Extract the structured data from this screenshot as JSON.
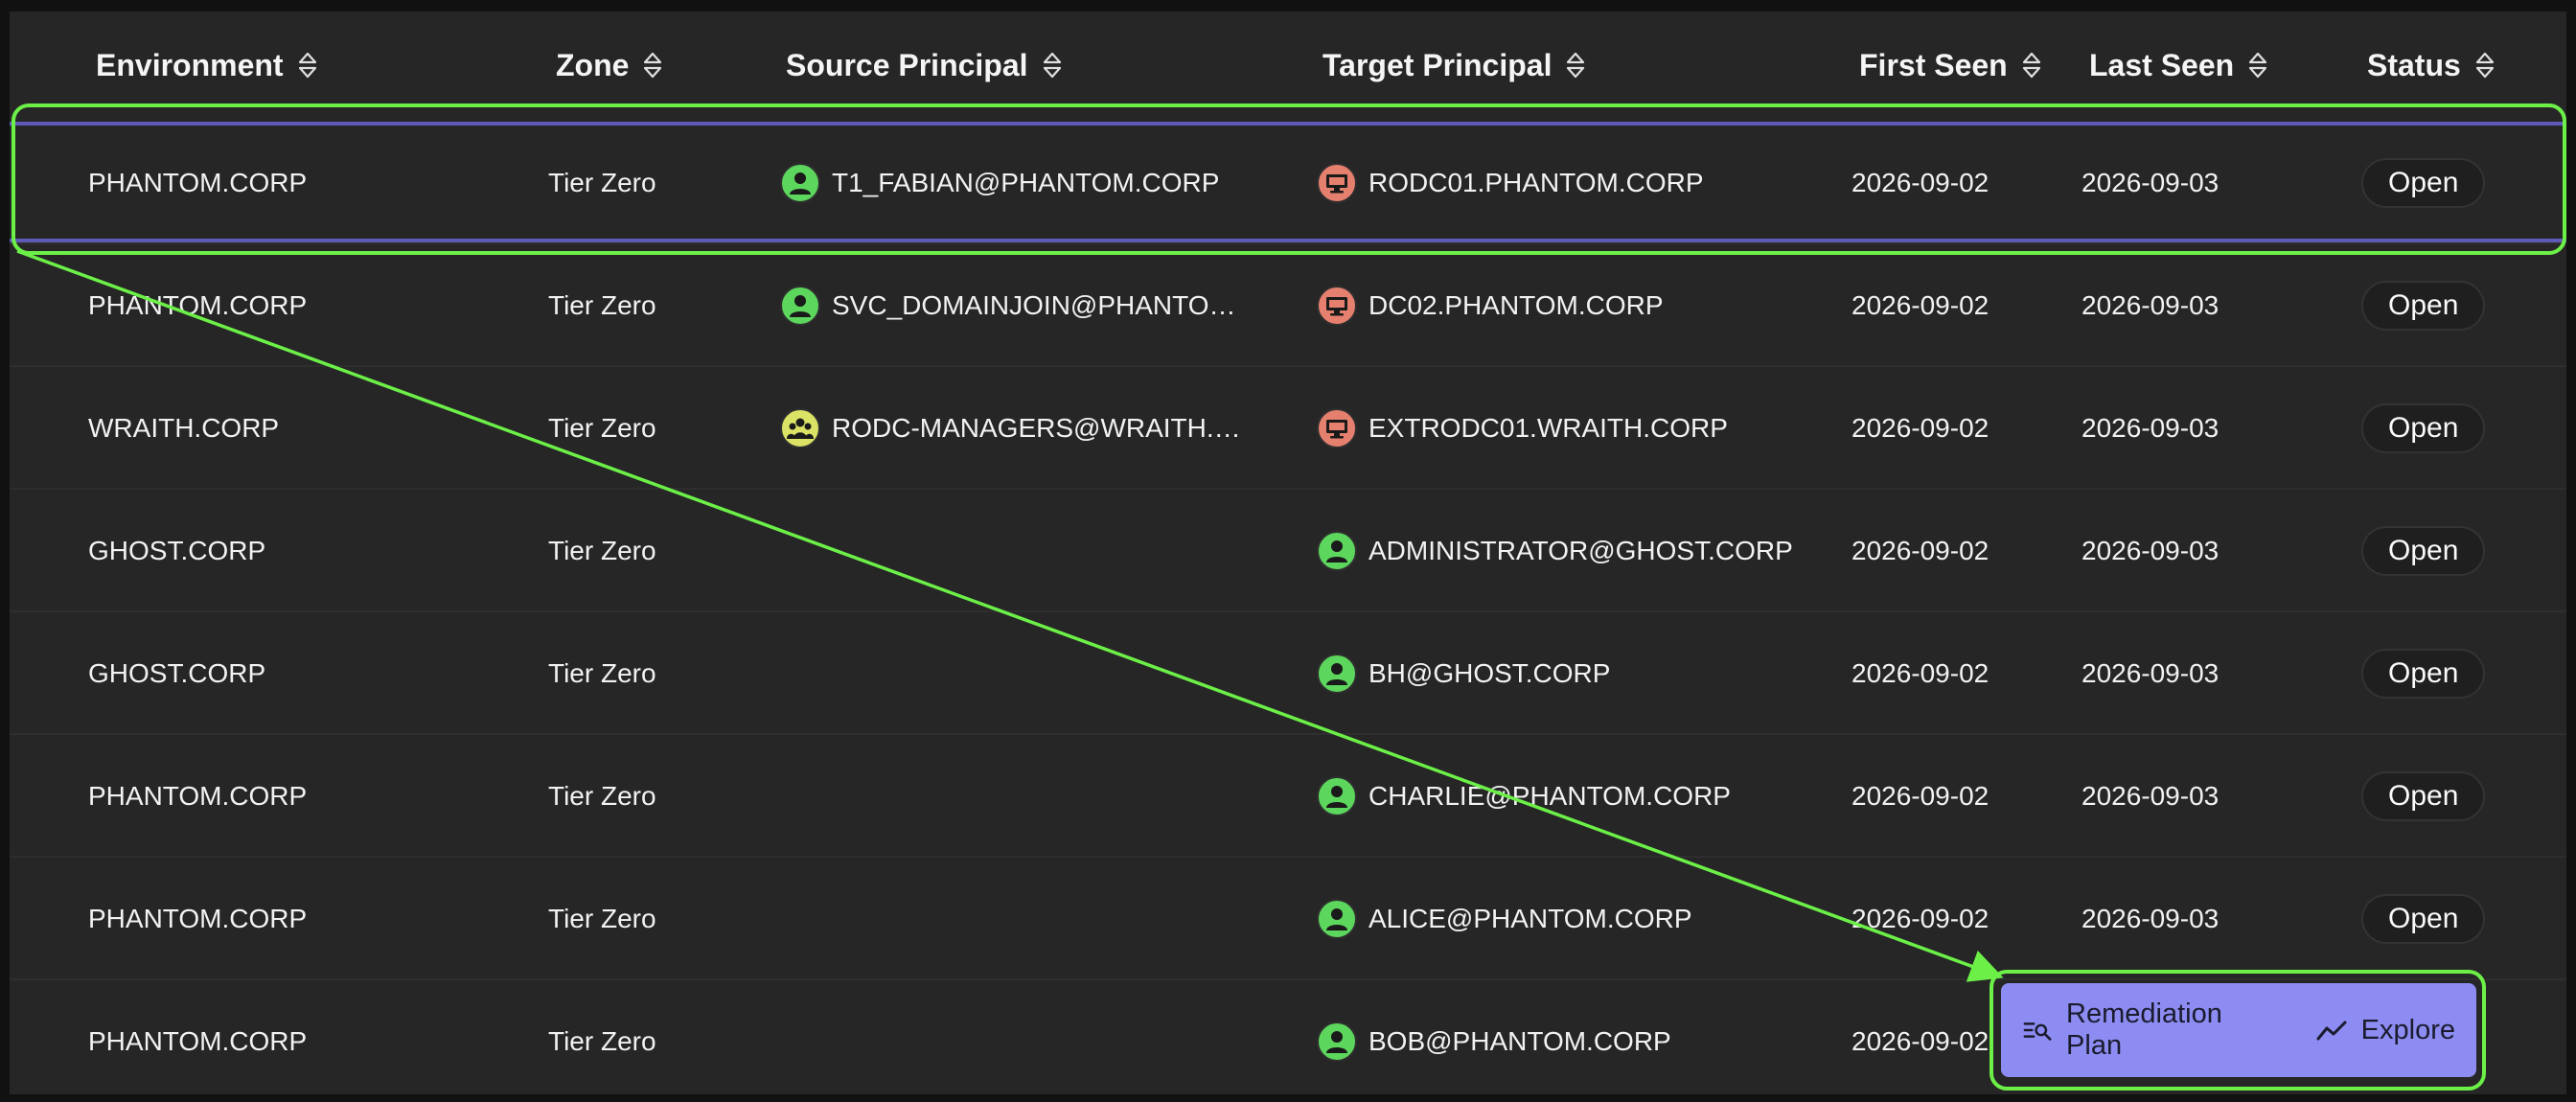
{
  "table": {
    "columns": [
      {
        "label": "Environment"
      },
      {
        "label": "Zone"
      },
      {
        "label": "Source Principal"
      },
      {
        "label": "Target Principal"
      },
      {
        "label": "First Seen"
      },
      {
        "label": "Last Seen"
      },
      {
        "label": "Status"
      }
    ],
    "rows": [
      {
        "environment": "PHANTOM.CORP",
        "zone": "Tier Zero",
        "source": "T1_FABIAN@PHANTOM.CORP",
        "source_icon": "user-icon",
        "target": "RODC01.PHANTOM.CORP",
        "target_icon": "computer-icon",
        "first_seen": "2026-09-02",
        "last_seen": "2026-09-03",
        "status": "Open"
      },
      {
        "environment": "PHANTOM.CORP",
        "zone": "Tier Zero",
        "source": "SVC_DOMAINJOIN@PHANTOM.CORP",
        "source_icon": "user-icon",
        "target": "DC02.PHANTOM.CORP",
        "target_icon": "computer-icon",
        "first_seen": "2026-09-02",
        "last_seen": "2026-09-03",
        "status": "Open"
      },
      {
        "environment": "WRAITH.CORP",
        "zone": "Tier Zero",
        "source": "RODC-MANAGERS@WRAITH.CORP",
        "source_icon": "group-icon",
        "target": "EXTRODC01.WRAITH.CORP",
        "target_icon": "computer-icon",
        "first_seen": "2026-09-02",
        "last_seen": "2026-09-03",
        "status": "Open"
      },
      {
        "environment": "GHOST.CORP",
        "zone": "Tier Zero",
        "source": "",
        "source_icon": "",
        "target": "ADMINISTRATOR@GHOST.CORP",
        "target_icon": "user-icon",
        "first_seen": "2026-09-02",
        "last_seen": "2026-09-03",
        "status": "Open"
      },
      {
        "environment": "GHOST.CORP",
        "zone": "Tier Zero",
        "source": "",
        "source_icon": "",
        "target": "BH@GHOST.CORP",
        "target_icon": "user-icon",
        "first_seen": "2026-09-02",
        "last_seen": "2026-09-03",
        "status": "Open"
      },
      {
        "environment": "PHANTOM.CORP",
        "zone": "Tier Zero",
        "source": "",
        "source_icon": "",
        "target": "CHARLIE@PHANTOM.CORP",
        "target_icon": "user-icon",
        "first_seen": "2026-09-02",
        "last_seen": "2026-09-03",
        "status": "Open"
      },
      {
        "environment": "PHANTOM.CORP",
        "zone": "Tier Zero",
        "source": "",
        "source_icon": "",
        "target": "ALICE@PHANTOM.CORP",
        "target_icon": "user-icon",
        "first_seen": "2026-09-02",
        "last_seen": "2026-09-03",
        "status": "Open"
      },
      {
        "environment": "PHANTOM.CORP",
        "zone": "Tier Zero",
        "source": "",
        "source_icon": "",
        "target": "BOB@PHANTOM.CORP",
        "target_icon": "user-icon",
        "first_seen": "2026-09-02",
        "last_seen": "",
        "status": ""
      }
    ]
  },
  "actions": {
    "remediation_label": "Remediation Plan",
    "remediation_icon": "search-list-icon",
    "explore_label": "Explore",
    "explore_icon": "trend-line-icon"
  },
  "colors": {
    "annotation": "#6cf048",
    "action_bar": "#8c8cf2",
    "selected_row_border": "#5d5ab8",
    "user_icon": "#5cd65c",
    "computer_icon": "#e5806f",
    "group_icon": "#dbe366"
  }
}
